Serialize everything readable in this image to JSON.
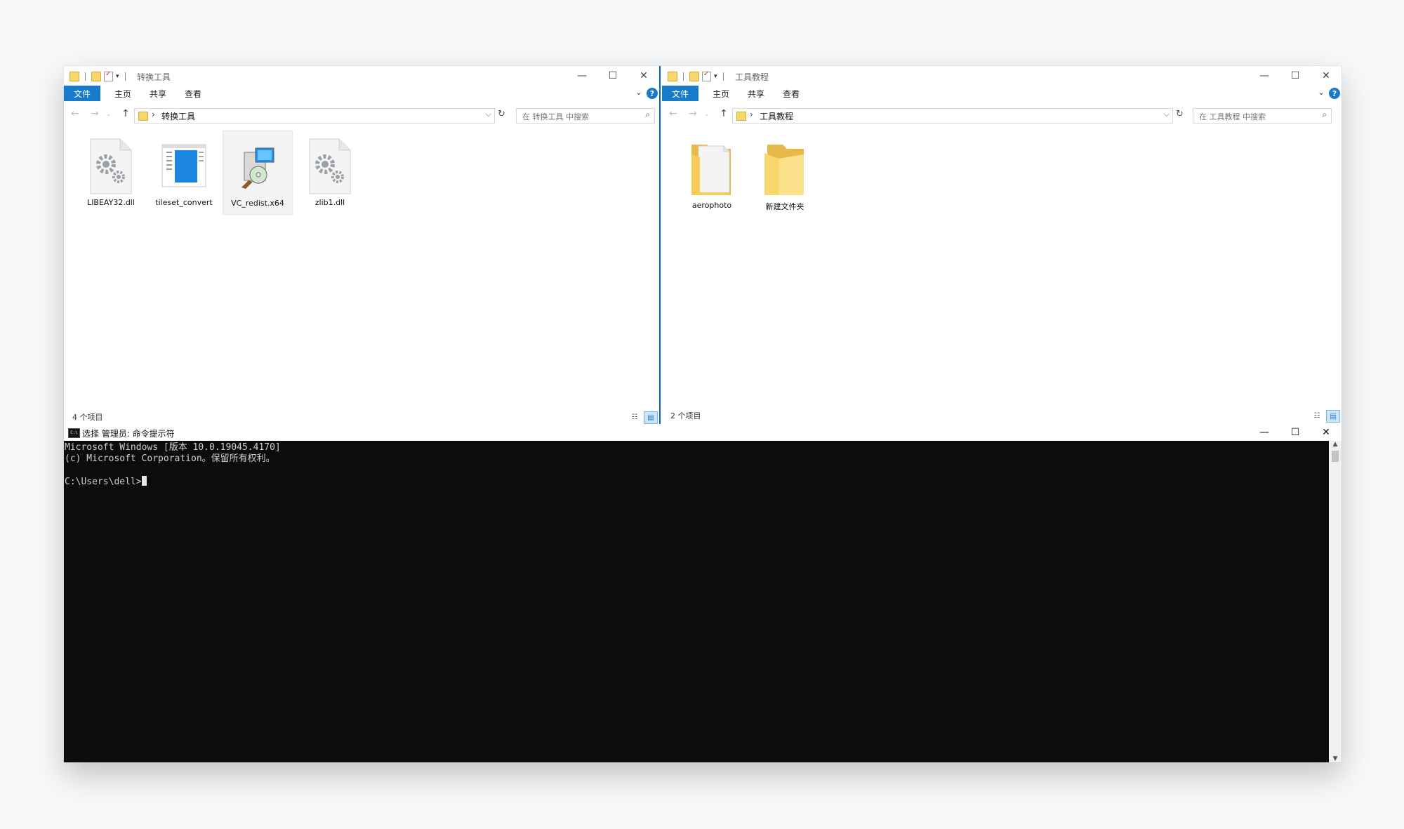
{
  "left_window": {
    "title": "转换工具",
    "tabs": [
      "文件",
      "主页",
      "共享",
      "查看"
    ],
    "address": "转换工具",
    "search_placeholder": "在 转换工具 中搜索",
    "files": [
      {
        "name": "LIBEAY32.dll",
        "icon": "dll-gear-icon"
      },
      {
        "name": "tileset_convert",
        "icon": "application-icon"
      },
      {
        "name": "VC_redist.x64",
        "icon": "installer-icon"
      },
      {
        "name": "zlib1.dll",
        "icon": "dll-gear-icon"
      }
    ],
    "status": "4 个项目"
  },
  "right_window": {
    "title": "工具教程",
    "tabs": [
      "文件",
      "主页",
      "共享",
      "查看"
    ],
    "address": "工具教程",
    "search_placeholder": "在 工具教程 中搜索",
    "files": [
      {
        "name": "aerophoto",
        "icon": "folder-with-document-icon"
      },
      {
        "name": "新建文件夹",
        "icon": "folder-icon"
      }
    ],
    "status": "2 个项目"
  },
  "console": {
    "title": "选择 管理员: 命令提示符",
    "icon_label": "C:\\",
    "lines": [
      "Microsoft Windows [版本 10.0.19045.4170]",
      "(c) Microsoft Corporation。保留所有权利。",
      "",
      "C:\\Users\\dell>"
    ]
  },
  "colors": {
    "accent": "#1979ca",
    "console_bg": "#0c0c0c",
    "folder": "#f8d66b"
  }
}
